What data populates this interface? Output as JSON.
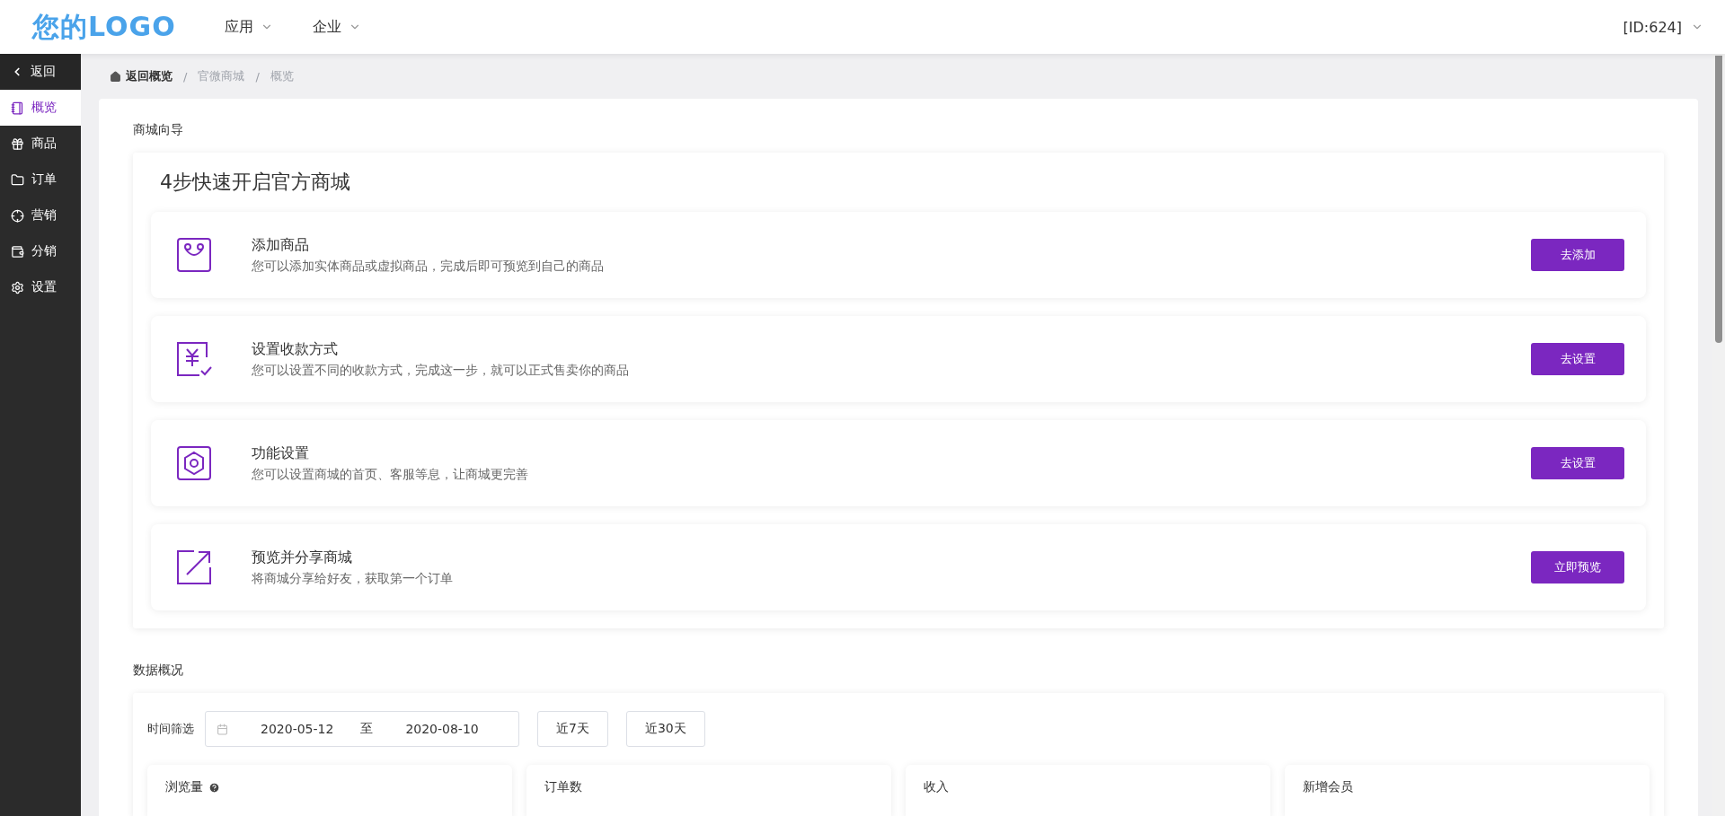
{
  "header": {
    "logo": "您的LOGO",
    "nav": [
      {
        "label": "应用"
      },
      {
        "label": "企业"
      }
    ],
    "account": "[ID:624]"
  },
  "sidebar": {
    "back": "返回",
    "items": [
      {
        "label": "概览",
        "kind": "notebook",
        "selected": true
      },
      {
        "label": "商品",
        "kind": "gift",
        "selected": false
      },
      {
        "label": "订单",
        "kind": "folder",
        "selected": false
      },
      {
        "label": "营销",
        "kind": "crosshair",
        "selected": false
      },
      {
        "label": "分销",
        "kind": "wallet",
        "selected": false
      },
      {
        "label": "设置",
        "kind": "gear",
        "selected": false
      }
    ]
  },
  "breadcrumb": {
    "separator": "/",
    "items": [
      "返回概览",
      "官微商城",
      "概览"
    ]
  },
  "guide": {
    "section_title": "商城向导",
    "heading": "4步快速开启官方商城",
    "steps": [
      {
        "kind": "bag",
        "title": "添加商品",
        "description": "您可以添加实体商品或虚拟商品，完成后即可预览到自己的商品",
        "action": "去添加"
      },
      {
        "kind": "yen",
        "title": "设置收款方式",
        "description": "您可以设置不同的收款方式，完成这一步，就可以正式售卖你的商品",
        "action": "去设置"
      },
      {
        "kind": "hexagon",
        "title": "功能设置",
        "description": "您可以设置商城的首页、客服等息，让商城更完善",
        "action": "去设置"
      },
      {
        "kind": "share",
        "title": "预览并分享商城",
        "description": "将商城分享给好友，获取第一个订单",
        "action": "立即预览"
      }
    ]
  },
  "data_overview": {
    "section_title": "数据概况",
    "filter_label": "时间筛选",
    "start_date": "2020-05-12",
    "separator": "至",
    "end_date": "2020-08-10",
    "quick_ranges": [
      "近7天",
      "近30天"
    ],
    "stats": [
      {
        "label": "浏览量",
        "help": true
      },
      {
        "label": "订单数",
        "help": false
      },
      {
        "label": "收入",
        "help": false
      },
      {
        "label": "新增会员",
        "help": false
      }
    ]
  }
}
